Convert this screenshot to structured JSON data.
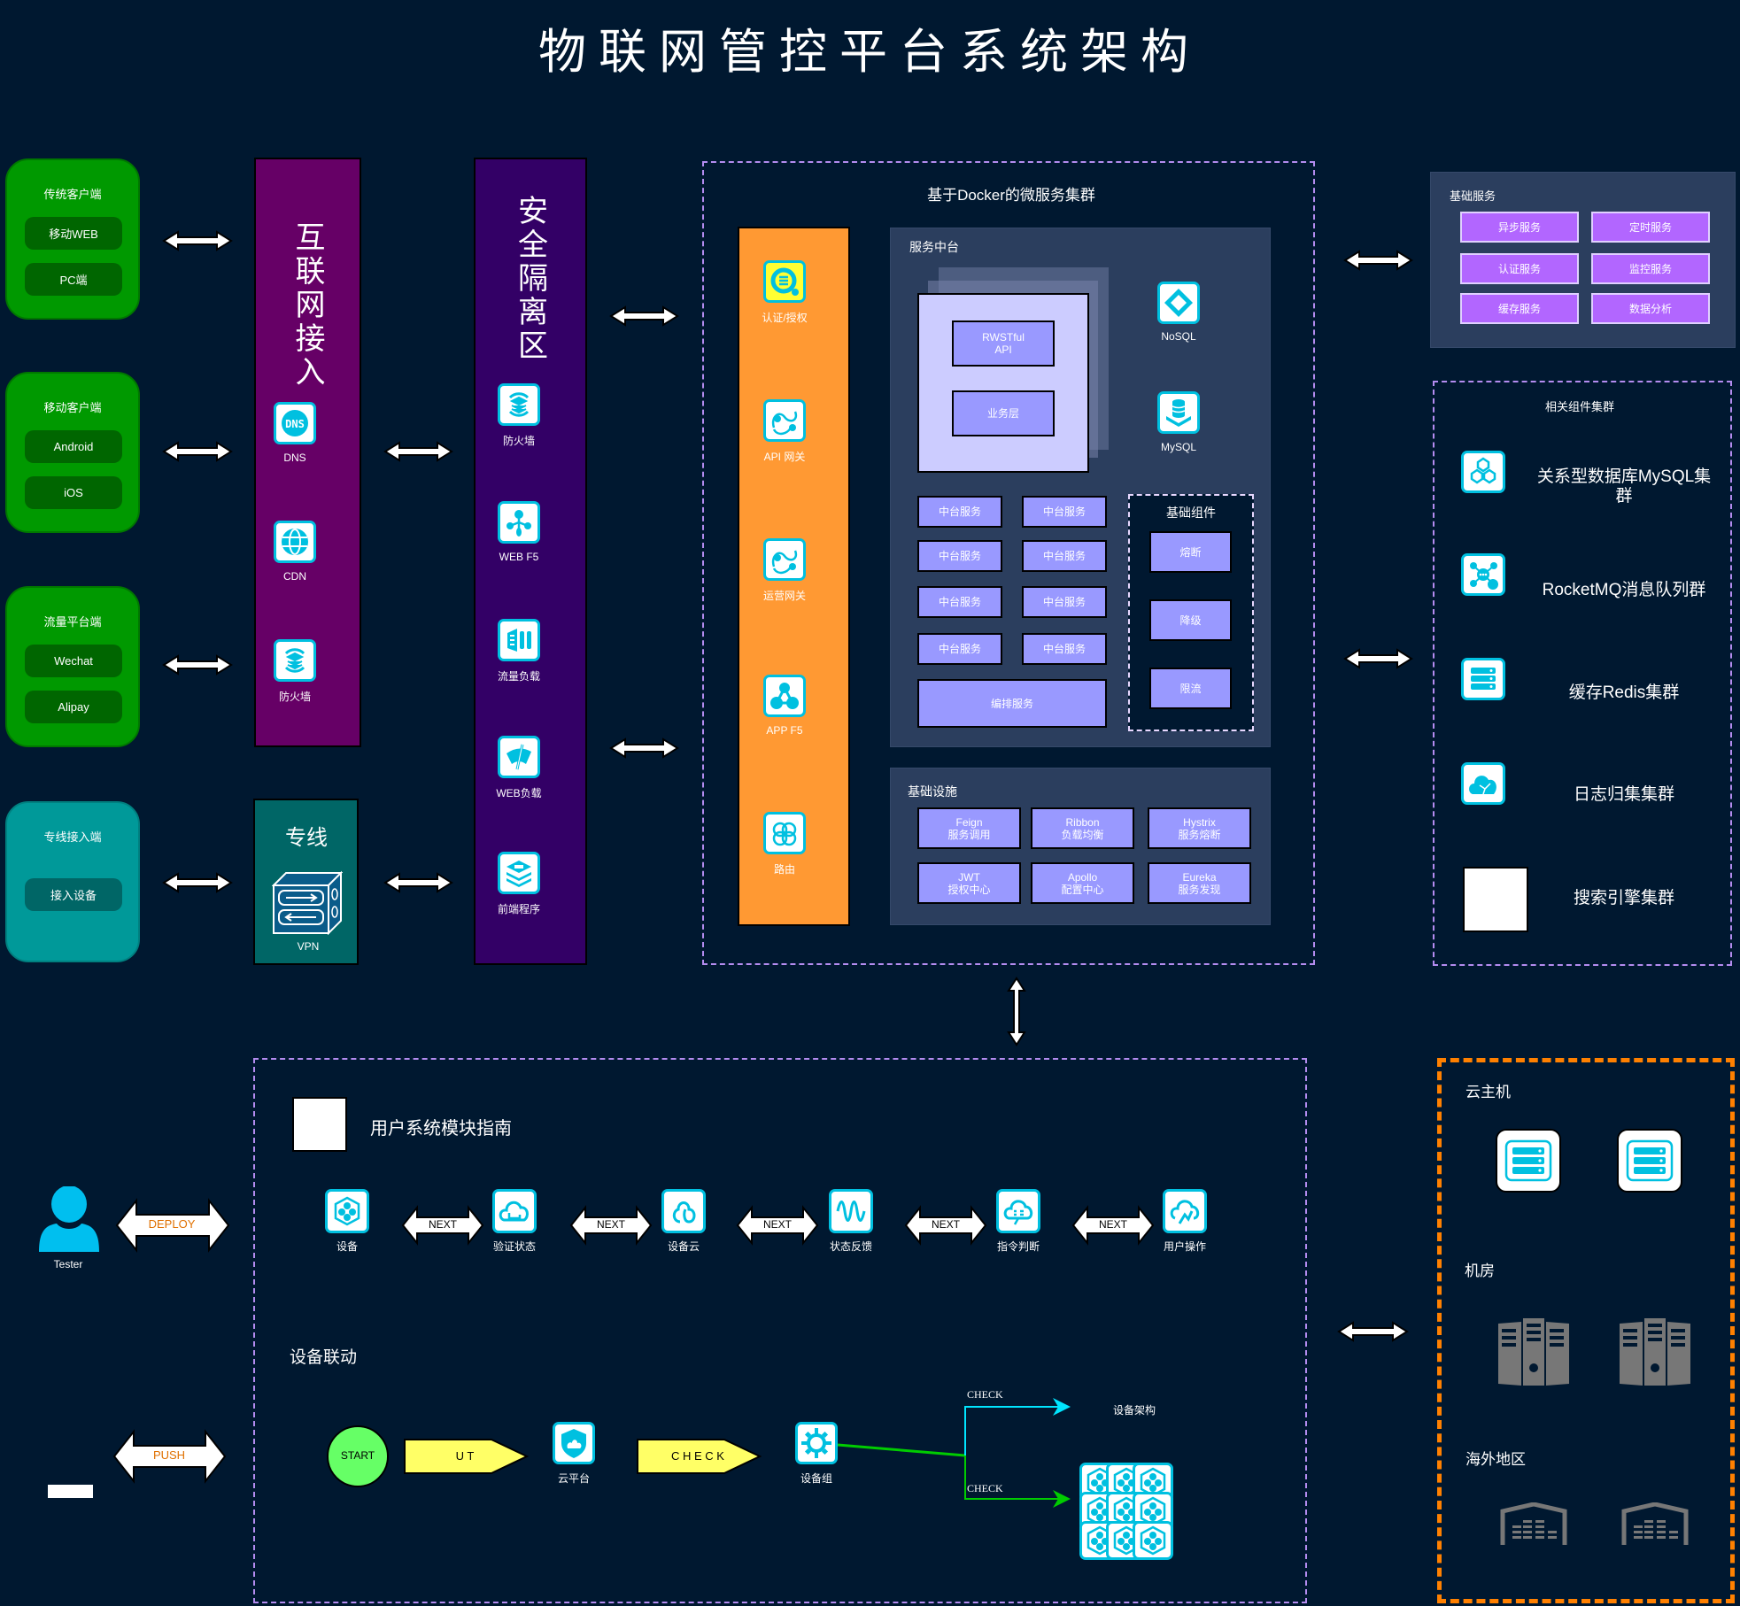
{
  "title": "物联网管控平台系统架构",
  "colors": {
    "background": "#001830",
    "client_green": "#009900",
    "client_teal": "#009999",
    "internet": "#660066",
    "security": "#330066",
    "dedicated": "#006666",
    "gateway": "#ff9933",
    "panel": "#2b3e5e",
    "service_box": "#9999ff",
    "basic_service": "#b266ff",
    "icon_border": "#00c0e0",
    "cluster_border": "#b48cf0",
    "host_border": "#ff8000"
  },
  "clients": [
    {
      "title": "传统客户端",
      "items": [
        "移动WEB",
        "PC端"
      ]
    },
    {
      "title": "移动客户端",
      "items": [
        "Android",
        "iOS"
      ]
    },
    {
      "title": "流量平台端",
      "items": [
        "Wechat",
        "Alipay"
      ]
    },
    {
      "title": "专线接入端",
      "items": [
        "接入设备"
      ]
    }
  ],
  "internet": {
    "title": "互联网接入",
    "items": [
      {
        "label": "DNS",
        "icon": "dns"
      },
      {
        "label": "CDN",
        "icon": "globe"
      },
      {
        "label": "防火墙",
        "icon": "firewall"
      }
    ]
  },
  "dedicated": {
    "title": "专线",
    "vpn": "VPN"
  },
  "security": {
    "title": "安全隔离区",
    "items": [
      {
        "label": "防火墙",
        "icon": "firewall"
      },
      {
        "label": "WEB F5",
        "icon": "share"
      },
      {
        "label": "流量负载",
        "icon": "balance"
      },
      {
        "label": "WEB负载",
        "icon": "gauge"
      },
      {
        "label": "前端程序",
        "icon": "layers"
      }
    ]
  },
  "docker": {
    "title": "基于Docker的微服务集群",
    "gateway": [
      {
        "label": "认证/授权",
        "icon": "search-doc"
      },
      {
        "label": "API 网关",
        "icon": "gateway"
      },
      {
        "label": "运营网关",
        "icon": "gateway"
      },
      {
        "label": "APP F5",
        "icon": "app"
      },
      {
        "label": "路由",
        "icon": "route"
      }
    ],
    "service_center": {
      "title": "服务中台",
      "api": "RWSTful API",
      "business": "业务层",
      "nosql": "NoSQL",
      "mysql": "MySQL",
      "services": [
        "中台服务",
        "中台服务",
        "中台服务",
        "中台服务",
        "中台服务",
        "中台服务",
        "中台服务",
        "中台服务"
      ],
      "orchestration": "编排服务",
      "components": {
        "title": "基础组件",
        "items": [
          "熔断",
          "降级",
          "限流"
        ]
      }
    },
    "infra": {
      "title": "基础设施",
      "items": [
        {
          "name": "Feign",
          "desc": "服务调用"
        },
        {
          "name": "Ribbon",
          "desc": "负载均衡"
        },
        {
          "name": "Hystrix",
          "desc": "服务熔断"
        },
        {
          "name": "JWT",
          "desc": "授权中心"
        },
        {
          "name": "Apollo",
          "desc": "配置中心"
        },
        {
          "name": "Eureka",
          "desc": "服务发现"
        }
      ]
    }
  },
  "basic_services": {
    "title": "基础服务",
    "items": [
      "异步服务",
      "定时服务",
      "认证服务",
      "监控服务",
      "缓存服务",
      "数据分析"
    ]
  },
  "cluster": {
    "title": "相关组件集群",
    "items": [
      {
        "label": "关系型数据库MySQL集群",
        "icon": "hexagons"
      },
      {
        "label": "RocketMQ消息队列群",
        "icon": "mq"
      },
      {
        "label": "缓存Redis集群",
        "icon": "server"
      },
      {
        "label": "日志归集集群",
        "icon": "cloud-log"
      },
      {
        "label": "搜索引擎集群",
        "icon": "blank"
      }
    ]
  },
  "guide": {
    "title": "用户系统模块指南",
    "tester": "Tester",
    "deploy": "DEPLOY",
    "next": "NEXT",
    "push": "PUSH",
    "flow": [
      {
        "label": "设备",
        "icon": "chip"
      },
      {
        "label": "验证状态",
        "icon": "cloud-verify"
      },
      {
        "label": "设备云",
        "icon": "cloud-device"
      },
      {
        "label": "状态反馈",
        "icon": "wave"
      },
      {
        "label": "指令判断",
        "icon": "cloud-cmd"
      },
      {
        "label": "用户操作",
        "icon": "cloud-user"
      }
    ],
    "linkage": {
      "title": "设备联动",
      "start": "START",
      "ut": "U T",
      "cloud": "云平台",
      "check": "C H E C K",
      "group": "设备组",
      "check_top": "CHECK",
      "check_bottom": "CHECK",
      "arch": "设备架构"
    }
  },
  "hosts": {
    "cloud": "云主机",
    "room": "机房",
    "overseas": "海外地区"
  }
}
